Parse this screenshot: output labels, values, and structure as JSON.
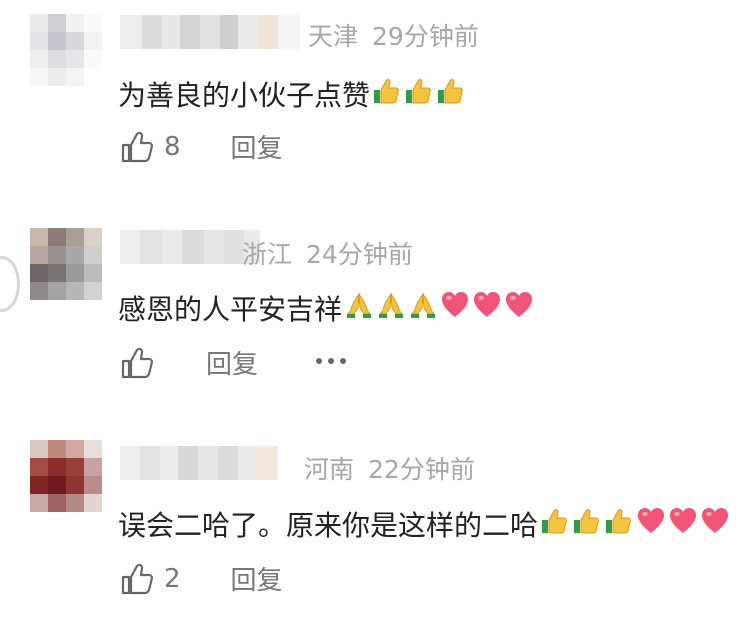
{
  "comments": [
    {
      "location": "天津",
      "time": "29分钟前",
      "text": "为善良的小伙子点赞",
      "emojis": [
        "thumbs-up",
        "thumbs-up",
        "thumbs-up"
      ],
      "like_count": "8",
      "reply_label": "回复",
      "avatar_colors": [
        "#ebebeb",
        "#d0cfd4",
        "#f1f1f1",
        "#fafafa",
        "#e4e3e7",
        "#c7c6cc",
        "#d9d8dd",
        "#f3f3f3",
        "#efefef",
        "#dedee2",
        "#e6e6e9",
        "#fafafa",
        "#f7f7f7",
        "#ececec",
        "#f4f4f4",
        "#ffffff"
      ],
      "name_colors": [
        "#eeeeee",
        "#dcdcdc",
        "#e8e8e8",
        "#d4d4d4",
        "#e1e1e1",
        "#cfcfcf",
        "#eaeaea",
        "#f0e5db",
        "#f4f4f4"
      ]
    },
    {
      "location": "浙江",
      "time": "24分钟前",
      "text": "感恩的人平安吉祥",
      "emojis": [
        "folded-hands",
        "folded-hands",
        "folded-hands",
        "heart",
        "heart",
        "heart"
      ],
      "like_count": "",
      "reply_label": "回复",
      "avatar_colors": [
        "#c9b9ad",
        "#8d7c74",
        "#a79f98",
        "#d9d2c6",
        "#b8a7a0",
        "#9a8f8f",
        "#a8a8a8",
        "#cfcfcf",
        "#6f6467",
        "#7a7374",
        "#9b9b9d",
        "#bcbcbc",
        "#8e8a8b",
        "#a3a3a3",
        "#b7b7b7",
        "#d2d2d2"
      ],
      "name_colors": [
        "#efefef",
        "#e3e3e3",
        "#ebebeb",
        "#dcdcdc",
        "#e6e6e6",
        "#e0e0e0",
        "#eaeaea"
      ]
    },
    {
      "location": "河南",
      "time": "22分钟前",
      "text": "误会二哈了。原来你是这样的二哈",
      "emojis": [
        "thumbs-up",
        "thumbs-up",
        "thumbs-up",
        "heart",
        "heart",
        "heart"
      ],
      "like_count": "2",
      "reply_label": "回复",
      "avatar_colors": [
        "#d8c8c4",
        "#c28a7b",
        "#d1a9a1",
        "#e9dede",
        "#a54a44",
        "#8a2c2a",
        "#9b3d39",
        "#c8a1a0",
        "#7f2523",
        "#6e1a1c",
        "#8e3532",
        "#bb8c8b",
        "#c7a9a8",
        "#9e6260",
        "#b28988",
        "#e3d5d4"
      ],
      "name_colors": [
        "#efefef",
        "#e3e3e3",
        "#ececec",
        "#d8d8d8",
        "#e6e6e6",
        "#dcdcdc",
        "#ebebeb",
        "#f2e8de"
      ]
    }
  ]
}
